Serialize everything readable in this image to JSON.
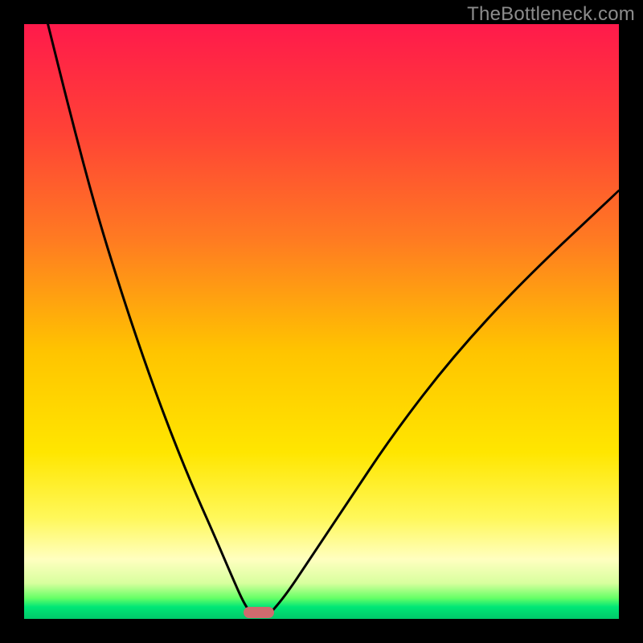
{
  "watermark": {
    "text": "TheBottleneck.com"
  },
  "colors": {
    "frame": "#000000",
    "watermark": "#8c8c8c",
    "curve": "#000000",
    "marker": "#cf6b6e",
    "gradient_stops": [
      {
        "offset": 0.0,
        "color": "#ff1a4b"
      },
      {
        "offset": 0.18,
        "color": "#ff4236"
      },
      {
        "offset": 0.36,
        "color": "#ff7a22"
      },
      {
        "offset": 0.55,
        "color": "#ffc400"
      },
      {
        "offset": 0.72,
        "color": "#ffe600"
      },
      {
        "offset": 0.83,
        "color": "#fff85a"
      },
      {
        "offset": 0.9,
        "color": "#ffffc0"
      },
      {
        "offset": 0.94,
        "color": "#d8ff9e"
      },
      {
        "offset": 0.965,
        "color": "#66ff66"
      },
      {
        "offset": 0.98,
        "color": "#00e676"
      },
      {
        "offset": 1.0,
        "color": "#00c96a"
      }
    ]
  },
  "chart_data": {
    "type": "line",
    "title": "",
    "xlabel": "",
    "ylabel": "",
    "xlim": [
      0,
      100
    ],
    "ylim": [
      0,
      100
    ],
    "comment": "Two curved branches descending from high bottleneck (red) toward a minimum near x≈38 at y≈0 (green). Values are estimated from pixel positions; the chart has no numeric axes.",
    "series": [
      {
        "name": "left-branch",
        "x": [
          4,
          8,
          12,
          16,
          20,
          24,
          28,
          32,
          35,
          37,
          38.5
        ],
        "values": [
          100,
          84,
          69,
          56,
          44,
          33,
          23,
          14,
          7,
          2.5,
          0.5
        ]
      },
      {
        "name": "right-branch",
        "x": [
          41,
          44,
          48,
          54,
          62,
          72,
          84,
          100
        ],
        "values": [
          0.5,
          4,
          10,
          19,
          31,
          44,
          57,
          72
        ]
      }
    ],
    "marker": {
      "x": 39.5,
      "y": 1.1,
      "shape": "pill",
      "color": "#cf6b6e"
    }
  }
}
